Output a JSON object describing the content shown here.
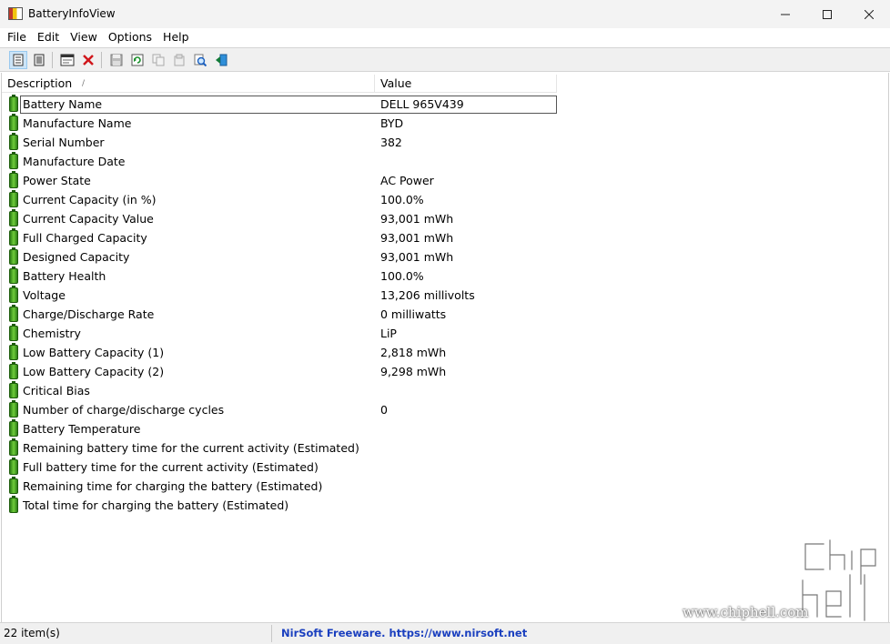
{
  "window": {
    "title": "BatteryInfoView",
    "minimize_glyph": "—",
    "maximize_glyph": "☐",
    "close_glyph": "✕"
  },
  "menu": [
    "File",
    "Edit",
    "View",
    "Options",
    "Help"
  ],
  "toolbar": {
    "buttons": [
      {
        "icon": "battery-info-view-icon",
        "active": true
      },
      {
        "icon": "battery-log-view-icon",
        "active": false
      },
      {
        "icon": "properties-window-icon",
        "active": false
      },
      {
        "icon": "delete-x-icon",
        "active": false
      },
      {
        "icon": "save-icon",
        "active": false
      },
      {
        "icon": "refresh-icon",
        "active": false
      },
      {
        "icon": "copy-icon",
        "active": false
      },
      {
        "icon": "html-report-icon",
        "active": false
      },
      {
        "icon": "find-icon",
        "active": false
      },
      {
        "icon": "exit-icon",
        "active": false
      }
    ]
  },
  "list": {
    "columns": {
      "description": "Description",
      "value": "Value"
    },
    "sort_indicator": "/",
    "rows": [
      {
        "description": "Battery Name",
        "value": "DELL 965V439"
      },
      {
        "description": "Manufacture Name",
        "value": "BYD"
      },
      {
        "description": "Serial Number",
        "value": "382"
      },
      {
        "description": "Manufacture Date",
        "value": ""
      },
      {
        "description": "Power State",
        "value": "AC Power"
      },
      {
        "description": "Current Capacity (in %)",
        "value": "100.0%"
      },
      {
        "description": "Current Capacity Value",
        "value": "93,001 mWh"
      },
      {
        "description": "Full Charged Capacity",
        "value": "93,001 mWh"
      },
      {
        "description": "Designed Capacity",
        "value": "93,001 mWh"
      },
      {
        "description": "Battery Health",
        "value": "100.0%"
      },
      {
        "description": "Voltage",
        "value": "13,206 millivolts"
      },
      {
        "description": "Charge/Discharge Rate",
        "value": "0 milliwatts"
      },
      {
        "description": "Chemistry",
        "value": "LiP"
      },
      {
        "description": "Low Battery Capacity (1)",
        "value": "2,818 mWh"
      },
      {
        "description": "Low Battery Capacity (2)",
        "value": "9,298 mWh"
      },
      {
        "description": "Critical Bias",
        "value": ""
      },
      {
        "description": "Number of charge/discharge cycles",
        "value": "0"
      },
      {
        "description": "Battery Temperature",
        "value": ""
      },
      {
        "description": "Remaining battery time for the current activity (Estimated)",
        "value": ""
      },
      {
        "description": "Full battery time for the current activity (Estimated)",
        "value": ""
      },
      {
        "description": "Remaining time for charging the battery (Estimated)",
        "value": ""
      },
      {
        "description": "Total  time for charging the battery (Estimated)",
        "value": ""
      }
    ]
  },
  "status": {
    "count": "22 item(s)",
    "link": "NirSoft Freeware. https://www.nirsoft.net"
  },
  "watermark": {
    "text": "www.chiphell.com",
    "logo_text": "chip hell"
  }
}
